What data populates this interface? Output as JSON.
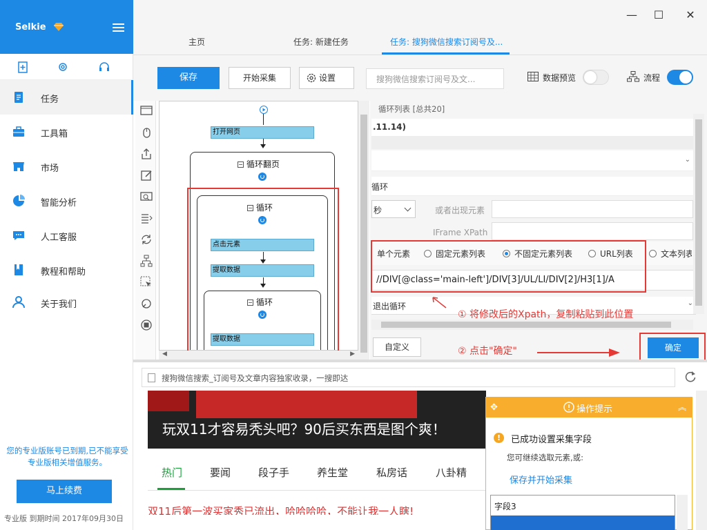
{
  "app": {
    "brand": "Selkie"
  },
  "window": {
    "minimize": "—",
    "maximize": "☐",
    "close": "✕"
  },
  "tabs": [
    {
      "label": "主页"
    },
    {
      "label": "任务: 新建任务"
    },
    {
      "label": "任务: 搜狗微信搜索订阅号及..."
    }
  ],
  "sidebar": {
    "items": [
      {
        "label": "任务"
      },
      {
        "label": "工具箱"
      },
      {
        "label": "市场"
      },
      {
        "label": "智能分析"
      },
      {
        "label": "人工客服"
      },
      {
        "label": "教程和帮助"
      },
      {
        "label": "关于我们"
      }
    ],
    "expire_msg": "您的专业版账号已到期,已不能享受专业版相关增值服务。",
    "renew_label": "马上续费",
    "edition": "专业版  到期时间 2017年09月30日"
  },
  "toolbar": {
    "save_label": "保存",
    "start_label": "开始采集",
    "settings_label": "设置",
    "task_name": "搜狗微信搜索订阅号及文...",
    "preview_label": "数据预览",
    "flow_label": "流程"
  },
  "flow": {
    "open_page": "打开网页",
    "loop_page": "循环翻页",
    "loop1": "循环",
    "click": "点击元素",
    "extract1": "提取数据",
    "loop2": "循环",
    "extract2": "提取数据"
  },
  "panel": {
    "header": "循环列表 [总共20]",
    "version_text": ".11.14)",
    "loop_type": "循环",
    "seconds": "秒",
    "or_element_label": "或者出现元素",
    "iframe_label": "IFrame XPath",
    "radios": [
      {
        "label": "单个元素",
        "checked": false
      },
      {
        "label": "固定元素列表",
        "checked": false
      },
      {
        "label": "不固定元素列表",
        "checked": true
      },
      {
        "label": "URL列表",
        "checked": false
      },
      {
        "label": "文本列表",
        "checked": false
      }
    ],
    "xpath": "//DIV[@class='main-left']/DIV[3]/UL/LI/DIV[2]/H3[1]/A",
    "exit_loop": "退出循环",
    "custom_label": "自定义",
    "confirm_label": "确定"
  },
  "annotations": {
    "step1": "① 将修改后的Xpath，复制粘贴到此位置",
    "step2": "② 点击\"确定\"",
    "color": "#e53935"
  },
  "browser": {
    "address": "搜狗微信搜索_订阅号及文章内容独家收录，一搜即达",
    "banner_title": "玩双11才容易秃头吧？90后买东西是图个爽！",
    "news_tabs": [
      {
        "label": "热门"
      },
      {
        "label": "要闻"
      },
      {
        "label": "段子手"
      },
      {
        "label": "养生堂"
      },
      {
        "label": "私房话"
      },
      {
        "label": "八卦精"
      }
    ],
    "headline": "双11后第一波买家秀已流出，哈哈哈哈，不能让我一人瞎!"
  },
  "hint": {
    "title": "操作提示",
    "success": "已成功设置采集字段",
    "continue": "您可继续选取元素,或:",
    "save_start": "保存并开始采集",
    "field3": "字段3"
  },
  "colors": {
    "accent": "#1e88e5",
    "alert": "#e53935",
    "hint": "#f8ad2c"
  }
}
